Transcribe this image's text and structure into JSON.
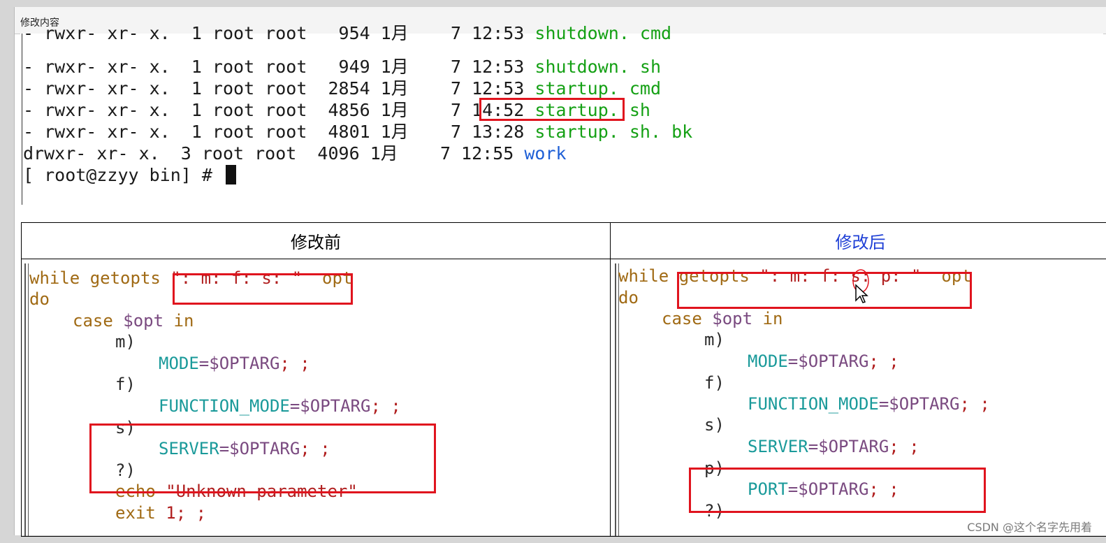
{
  "window": {
    "title": "修改内容"
  },
  "terminal": {
    "lines": [
      {
        "meta": "- rwxr- xr- x.  1 root root   954 1月    7 12:53 ",
        "name": "shutdown. cmd",
        "color": "green"
      },
      {
        "meta": "- rwxr- xr- x.  1 root root   949 1月    7 12:53 ",
        "name": "shutdown. sh",
        "color": "green"
      },
      {
        "meta": "- rwxr- xr- x.  1 root root  2854 1月    7 12:53 ",
        "name": "startup. cmd",
        "color": "green"
      },
      {
        "meta": "- rwxr- xr- x.  1 root root  4856 1月    7 14:52 ",
        "name": "startup. sh",
        "color": "green"
      },
      {
        "meta": "- rwxr- xr- x.  1 root root  4801 1月    7 13:28 ",
        "name": "startup. sh. bk",
        "color": "green"
      },
      {
        "meta": "drwxr- xr- x.  3 root root  4096 1月    7 12:55 ",
        "name": "work",
        "color": "blue"
      }
    ],
    "prompt": "[ root@zzyy bin] # "
  },
  "comparison": {
    "before_header": "修改前",
    "after_header": "修改后",
    "before_code": {
      "l1_kw": "while getopts ",
      "l1_str": "\": m: f: s: \"",
      "l1_opt": "  opt",
      "l2": "do",
      "l3_kw": "case ",
      "l3_var": "$opt",
      "l3_in": " in",
      "l4": "m)",
      "l5_name": "MODE",
      "l5_val": "=$OPTARG",
      "l5_end": "; ;",
      "l6": "f)",
      "l7_name": "FUNCTION_MODE",
      "l7_val": "=$OPTARG",
      "l7_end": "; ;",
      "l8": "s)",
      "l9_name": "SERVER",
      "l9_val": "=$OPTARG",
      "l9_end": "; ;",
      "l10": "?)",
      "l11_kw": "echo ",
      "l11_str": "\"Unknown parameter\"",
      "l12_kw": "exit ",
      "l12_num": "1",
      "l12_end": "; ;"
    },
    "after_code": {
      "l1_kw1": "while ",
      "l1_kw2": "getopts ",
      "l1_str": "\": m: f: s: p: \"",
      "l1_opt": "  opt",
      "l2": "do",
      "l3_kw": "case ",
      "l3_var": "$opt",
      "l3_in": " in",
      "l4": "m)",
      "l5_name": "MODE",
      "l5_val": "=$OPTARG",
      "l5_end": "; ;",
      "l6": "f)",
      "l7_name": "FUNCTION_MODE",
      "l7_val": "=$OPTARG",
      "l7_end": "; ;",
      "l8": "s)",
      "l9_name": "SERVER",
      "l9_val": "=$OPTARG",
      "l9_end": "; ;",
      "l10": "p)",
      "l11_name": "PORT",
      "l11_val": "=$OPTARG",
      "l11_end": "; ;",
      "l12": "?)"
    }
  },
  "watermark": "CSDN @这个名字先用着",
  "colors": {
    "highlight_box": "#e0141e",
    "file_green": "#14a014",
    "dir_blue": "#1e5fd6",
    "after_header": "#1e3fd6"
  }
}
